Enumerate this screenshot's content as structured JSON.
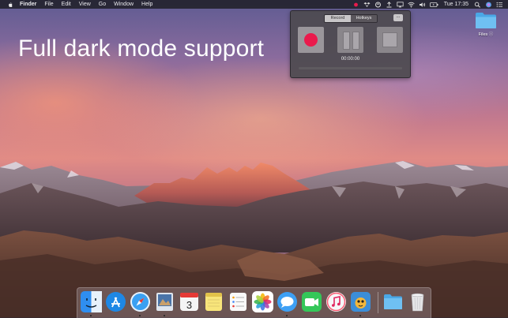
{
  "menubar": {
    "app_name": "Finder",
    "items": [
      "File",
      "Edit",
      "View",
      "Go",
      "Window",
      "Help"
    ],
    "clock": "Tue 17:35"
  },
  "headline": "Full dark mode support",
  "recorder": {
    "tabs": [
      "Record",
      "Hotkeys"
    ],
    "active_tab": "Record",
    "more_label": "...",
    "timer": "00:00:00",
    "record_color": "#ea1a4c",
    "progress": 0
  },
  "desktop": {
    "icon_label": "Files ⓘ"
  },
  "dock": {
    "apps": [
      {
        "name": "finder-icon",
        "color": "#2f8ef0"
      },
      {
        "name": "app-store-icon",
        "color": "#1e88e5"
      },
      {
        "name": "safari-icon",
        "color": "#3aa0f2"
      },
      {
        "name": "preview-icon",
        "color": "#4a74a8"
      },
      {
        "name": "calendar-icon",
        "color": "#f4f4f4",
        "text": "3"
      },
      {
        "name": "notes-icon",
        "color": "#f8e57a"
      },
      {
        "name": "reminders-icon",
        "color": "#fafafa"
      },
      {
        "name": "photos-icon",
        "color": "#ffffff"
      },
      {
        "name": "messages-icon",
        "color": "#3da0f5"
      },
      {
        "name": "facetime-icon",
        "color": "#34c759"
      },
      {
        "name": "itunes-icon",
        "color": "#f0f0f0"
      },
      {
        "name": "screen-recorder-icon",
        "color": "#3b8ed8"
      },
      {
        "name": "downloads-folder-icon",
        "color": "#62b8ef"
      },
      {
        "name": "trash-icon",
        "color": "#dcdcdc"
      }
    ]
  }
}
